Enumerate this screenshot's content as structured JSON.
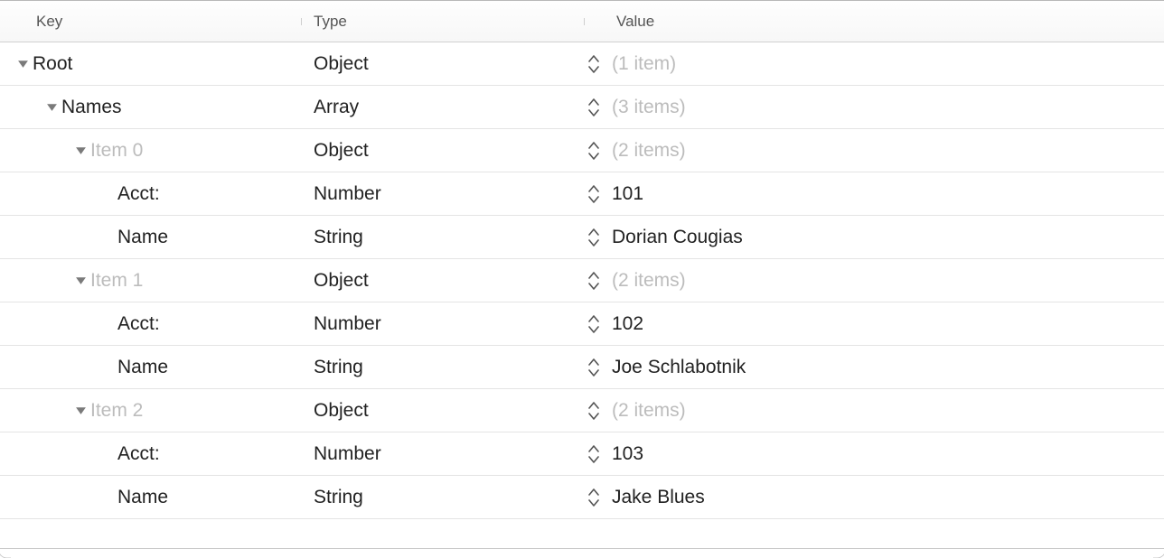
{
  "headers": {
    "key": "Key",
    "type": "Type",
    "value": "Value"
  },
  "rows": [
    {
      "key": "Root",
      "type": "Object",
      "value": "(1 item)",
      "muted_key": false,
      "muted_value": true,
      "disclosure": true,
      "indent": 0
    },
    {
      "key": "Names",
      "type": "Array",
      "value": "(3 items)",
      "muted_key": false,
      "muted_value": true,
      "disclosure": true,
      "indent": 1
    },
    {
      "key": "Item 0",
      "type": "Object",
      "value": "(2 items)",
      "muted_key": true,
      "muted_value": true,
      "disclosure": true,
      "indent": 2
    },
    {
      "key": "Acct:",
      "type": "Number",
      "value": "101",
      "muted_key": false,
      "muted_value": false,
      "disclosure": false,
      "indent": 3
    },
    {
      "key": "Name",
      "type": "String",
      "value": "Dorian Cougias",
      "muted_key": false,
      "muted_value": false,
      "disclosure": false,
      "indent": 3
    },
    {
      "key": "Item 1",
      "type": "Object",
      "value": "(2 items)",
      "muted_key": true,
      "muted_value": true,
      "disclosure": true,
      "indent": 2
    },
    {
      "key": "Acct:",
      "type": "Number",
      "value": "102",
      "muted_key": false,
      "muted_value": false,
      "disclosure": false,
      "indent": 3
    },
    {
      "key": "Name",
      "type": "String",
      "value": "Joe Schlabotnik",
      "muted_key": false,
      "muted_value": false,
      "disclosure": false,
      "indent": 3
    },
    {
      "key": "Item 2",
      "type": "Object",
      "value": "(2 items)",
      "muted_key": true,
      "muted_value": true,
      "disclosure": true,
      "indent": 2
    },
    {
      "key": "Acct:",
      "type": "Number",
      "value": "103",
      "muted_key": false,
      "muted_value": false,
      "disclosure": false,
      "indent": 3
    },
    {
      "key": "Name",
      "type": "String",
      "value": "Jake Blues",
      "muted_key": false,
      "muted_value": false,
      "disclosure": false,
      "indent": 3
    }
  ]
}
